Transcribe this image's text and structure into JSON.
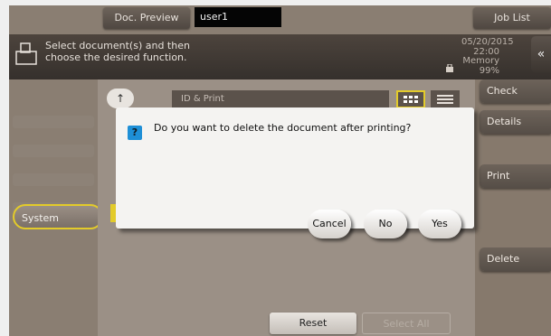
{
  "topbar": {
    "preview_label": "Doc. Preview",
    "user": "user1",
    "joblist_label": "Job List"
  },
  "info": {
    "message_line1": "Select document(s) and then",
    "message_line2": "choose the desired function.",
    "date": "05/20/2015",
    "time": "22:00",
    "memory_label": "Memory",
    "memory_value": "99%"
  },
  "right_menu": {
    "check_setting": "Check Setting",
    "details": "Details",
    "print": "Print",
    "delete": "Delete"
  },
  "left_menu": {
    "system": "System"
  },
  "toolbar": {
    "box_title": "ID & Print"
  },
  "bottom": {
    "reset": "Reset",
    "select_all": "Select All"
  },
  "dialog": {
    "question": "Do you want to delete the document after printing?",
    "cancel": "Cancel",
    "no": "No",
    "yes": "Yes"
  },
  "colors": {
    "background": "#8a7e72",
    "accent": "#e3cb2a",
    "dialog": "#f4f3f1",
    "question_icon": "#1e8fd6"
  }
}
